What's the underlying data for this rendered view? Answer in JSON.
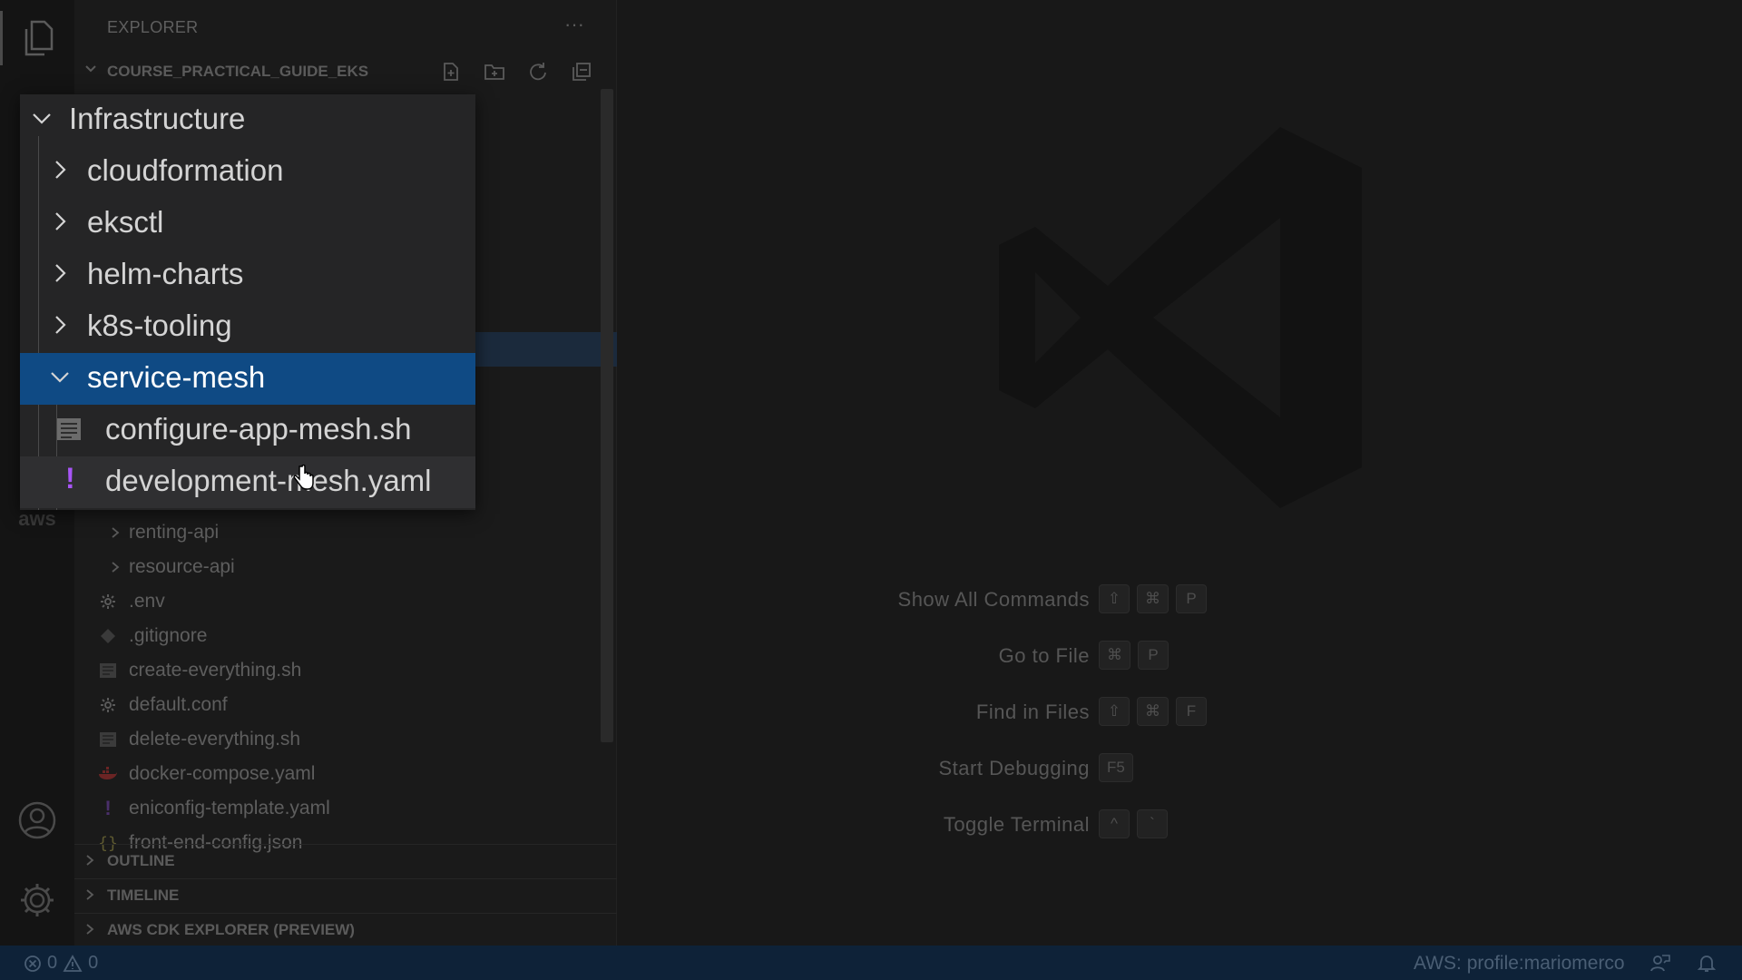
{
  "sidebar": {
    "header": "EXPLORER",
    "more_label": "···",
    "workspace": "COURSE_PRACTICAL_GUIDE_EKS",
    "files": [
      {
        "label": "renting-api",
        "icon": "chevron-right-icon"
      },
      {
        "label": "resource-api",
        "icon": "chevron-right-icon"
      },
      {
        "label": ".env",
        "icon": "gear-icon"
      },
      {
        "label": ".gitignore",
        "icon": "git-icon"
      },
      {
        "label": "create-everything.sh",
        "icon": "shell-file-icon"
      },
      {
        "label": "default.conf",
        "icon": "gear-icon"
      },
      {
        "label": "delete-everything.sh",
        "icon": "shell-file-icon"
      },
      {
        "label": "docker-compose.yaml",
        "icon": "docker-icon"
      },
      {
        "label": "eniconfig-template.yaml",
        "icon": "yaml-icon"
      },
      {
        "label": "front-end-config.json",
        "icon": "json-icon"
      }
    ],
    "panels": [
      {
        "label": "OUTLINE"
      },
      {
        "label": "TIMELINE"
      },
      {
        "label": "AWS CDK EXPLORER (PREVIEW)"
      }
    ]
  },
  "activity": {
    "aws_label": "aws"
  },
  "zoom_tree": [
    {
      "label": "Infrastructure",
      "expanded": true
    },
    {
      "label": "cloudformation",
      "expanded": false
    },
    {
      "label": "eksctl",
      "expanded": false
    },
    {
      "label": "helm-charts",
      "expanded": false
    },
    {
      "label": "k8s-tooling",
      "expanded": false
    },
    {
      "label": "service-mesh",
      "expanded": true
    },
    {
      "label": "configure-app-mesh.sh",
      "icon": "shell-file-icon"
    },
    {
      "label": "development-mesh.yaml",
      "icon": "yaml-icon"
    }
  ],
  "editor": {
    "hints": [
      {
        "label": "Show All Commands",
        "keys": [
          "⇧",
          "⌘",
          "P"
        ]
      },
      {
        "label": "Go to File",
        "keys": [
          "⌘",
          "P"
        ]
      },
      {
        "label": "Find in Files",
        "keys": [
          "⇧",
          "⌘",
          "F"
        ]
      },
      {
        "label": "Start Debugging",
        "keys": [
          "F5"
        ]
      },
      {
        "label": "Toggle Terminal",
        "keys": [
          "^",
          "`"
        ]
      }
    ]
  },
  "status": {
    "errors": "0",
    "warnings": "0",
    "aws_profile": "AWS: profile:mariomerco"
  },
  "colors": {
    "selection": "#0f4a84",
    "status_bar": "#0e2238",
    "yaml_accent": "#a855f7"
  }
}
